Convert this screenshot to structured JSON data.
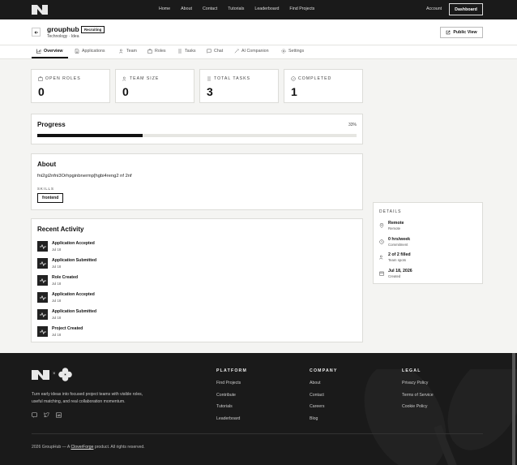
{
  "nav": {
    "links": [
      "Home",
      "About",
      "Contact",
      "Tutorials",
      "Leaderboard",
      "Find Projects"
    ],
    "account": "Account",
    "dashboard": "Dashboard"
  },
  "project": {
    "name": "grouphub",
    "badge": "Recruiting",
    "subtitle": "Technology · Idea",
    "public_view": "Public View"
  },
  "tabs": [
    {
      "label": "Overview",
      "icon": "chart-icon",
      "active": true
    },
    {
      "label": "Applications",
      "icon": "document-icon"
    },
    {
      "label": "Team",
      "icon": "users-icon"
    },
    {
      "label": "Roles",
      "icon": "briefcase-icon"
    },
    {
      "label": "Tasks",
      "icon": "list-icon"
    },
    {
      "label": "Chat",
      "icon": "chat-icon"
    },
    {
      "label": "AI Companion",
      "icon": "wand-icon"
    },
    {
      "label": "Settings",
      "icon": "gear-icon"
    }
  ],
  "stats": [
    {
      "label": "OPEN ROLES",
      "value": "0",
      "icon": "briefcase-icon"
    },
    {
      "label": "TEAM SIZE",
      "value": "0",
      "icon": "users-icon"
    },
    {
      "label": "TOTAL TASKS",
      "value": "3",
      "icon": "list-icon"
    },
    {
      "label": "COMPLETED",
      "value": "1",
      "icon": "check-circle-icon"
    }
  ],
  "progress": {
    "title": "Progress",
    "percent_label": "33%",
    "fraction": 0.33
  },
  "about": {
    "title": "About",
    "text": "fni2gi2nfni3Orhpginbnermp[hgbi4reng2 nf 2nf",
    "skills_label": "SKILLS",
    "skills": [
      "frontend"
    ]
  },
  "activity": {
    "title": "Recent Activity",
    "items": [
      {
        "title": "Application Accepted",
        "date": "Jul 18"
      },
      {
        "title": "Application Submitted",
        "date": "Jul 18"
      },
      {
        "title": "Role Created",
        "date": "Jul 18"
      },
      {
        "title": "Application Accepted",
        "date": "Jul 18"
      },
      {
        "title": "Application Submitted",
        "date": "Jul 18"
      },
      {
        "title": "Project Created",
        "date": "Jul 18"
      }
    ]
  },
  "details": {
    "title": "DETAILS",
    "items": [
      {
        "main": "Remote",
        "sub": "Remote",
        "icon": "pin-icon"
      },
      {
        "main": "0 hrs/week",
        "sub": "Commitment",
        "icon": "clock-icon"
      },
      {
        "main": "2 of 2 filled",
        "sub": "Team spots",
        "icon": "users-icon"
      },
      {
        "main": "Jul 18, 2026",
        "sub": "Created",
        "icon": "calendar-icon"
      }
    ]
  },
  "footer": {
    "x": "×",
    "description": "Turn early ideas into focused project teams with visible roles, useful matching, and real collaboration momentum.",
    "columns": [
      {
        "title": "PLATFORM",
        "links": [
          "Find Projects",
          "Contribute",
          "Tutorials",
          "Leaderboard"
        ]
      },
      {
        "title": "COMPANY",
        "links": [
          "About",
          "Contact",
          "Careers",
          "Blog"
        ]
      },
      {
        "title": "LEGAL",
        "links": [
          "Privacy Policy",
          "Terms of Service",
          "Cookie Policy"
        ]
      }
    ],
    "copyright_pre": "2026 GroupHub — A ",
    "copyright_link": "CloverForge",
    "copyright_post": " product. All rights reserved."
  }
}
